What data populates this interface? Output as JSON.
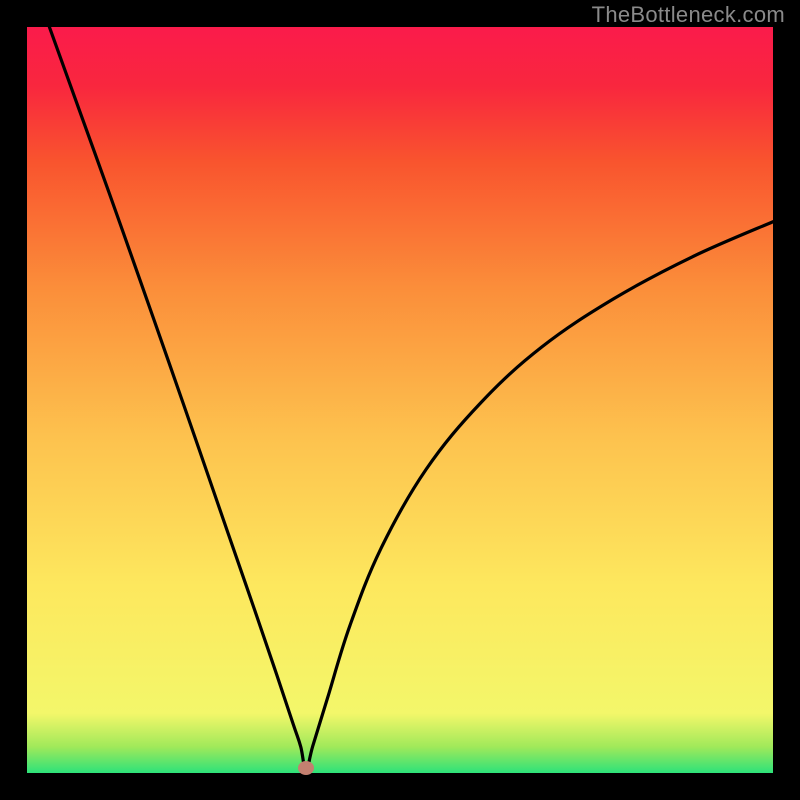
{
  "watermark": "TheBottleneck.com",
  "dot": {
    "x_pct": 37.4,
    "y_pct": 99.3
  },
  "chart_data": {
    "type": "line",
    "title": "",
    "xlabel": "",
    "ylabel": "",
    "xlim": [
      0,
      100
    ],
    "ylim": [
      0,
      100
    ],
    "grid": false,
    "legend": false,
    "note": "V-shaped bottleneck curve; y-axis depicts bottleneck severity (red high, green low). No numeric tick labels present; values estimated from pixel position.",
    "series": [
      {
        "name": "bottleneck-curve",
        "x": [
          3,
          7,
          11,
          15,
          19,
          23,
          27,
          30.5,
          33.5,
          35.7,
          36.7,
          37.4,
          38.3,
          40.3,
          43.3,
          47.5,
          53.5,
          60.8,
          69,
          78.7,
          89.2,
          100
        ],
        "y": [
          100,
          88.9,
          77.8,
          66.5,
          55.1,
          43.6,
          32.0,
          21.9,
          13.1,
          6.5,
          3.5,
          0.3,
          3.6,
          10.1,
          19.8,
          30.2,
          40.7,
          49.6,
          57.1,
          63.6,
          69.2,
          73.9
        ]
      }
    ],
    "marker": {
      "x": 37.4,
      "y": 0.7
    },
    "background_gradient": {
      "direction": "vertical",
      "stops": [
        {
          "pos": 0.0,
          "color": "#2de27a"
        },
        {
          "pos": 0.035,
          "color": "#a0e95a"
        },
        {
          "pos": 0.08,
          "color": "#f3f76a"
        },
        {
          "pos": 0.25,
          "color": "#fde85e"
        },
        {
          "pos": 0.45,
          "color": "#fdc24e"
        },
        {
          "pos": 0.65,
          "color": "#fb8e3a"
        },
        {
          "pos": 0.82,
          "color": "#f9542e"
        },
        {
          "pos": 0.92,
          "color": "#f9273e"
        },
        {
          "pos": 1.0,
          "color": "#fa1b4b"
        }
      ]
    }
  }
}
